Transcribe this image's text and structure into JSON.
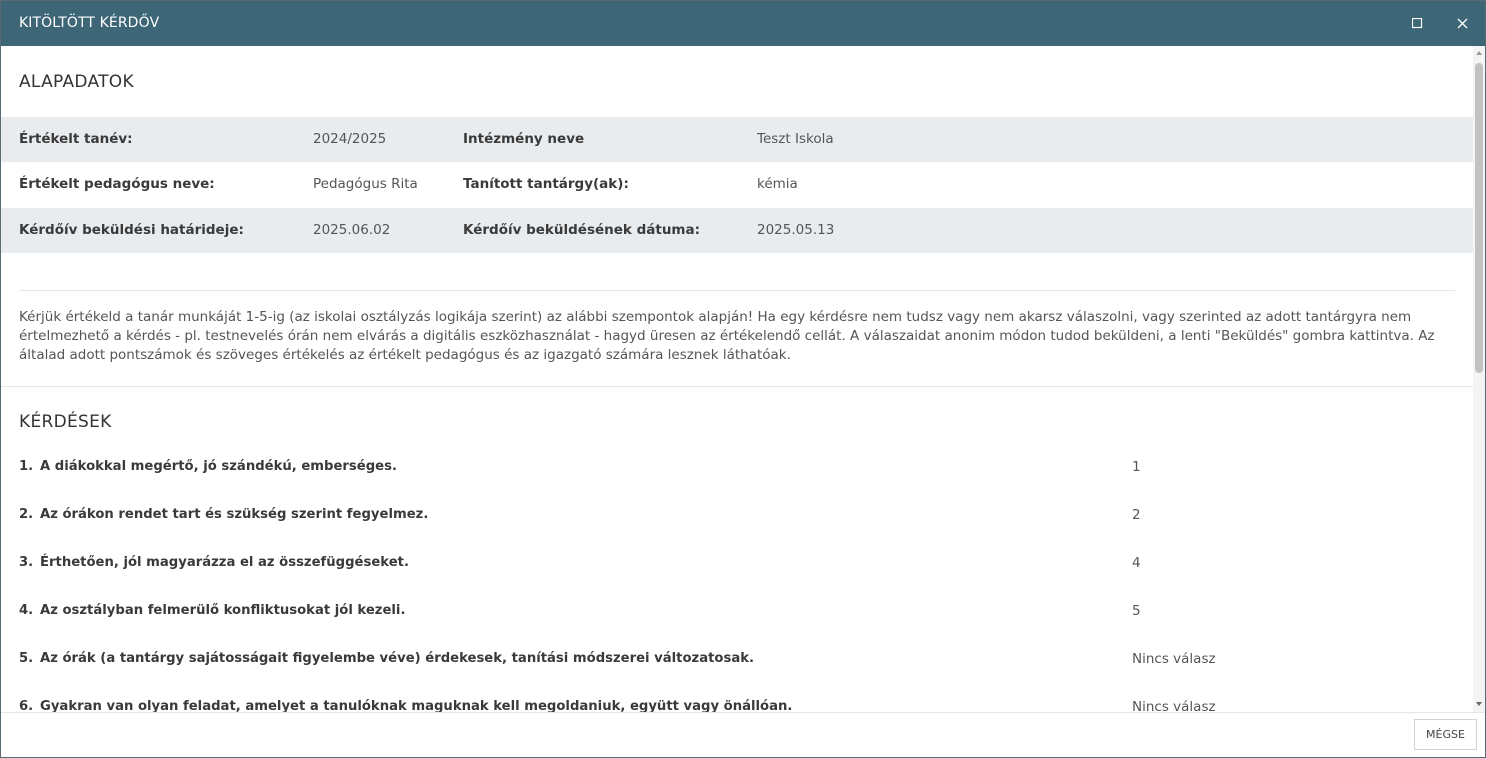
{
  "window": {
    "title": "KITÖLTÖTT KÉRDŐV",
    "maximize_icon": "maximize-icon",
    "close_icon": "close-icon",
    "title_bar_color": "#3d6677"
  },
  "basic_data": {
    "section_title": "ALAPADATOK",
    "rows": [
      {
        "label1": "Értékelt tanév:",
        "value1": "2024/2025",
        "label2": "Intézmény neve",
        "value2": "Teszt Iskola"
      },
      {
        "label1": "Értékelt pedagógus neve:",
        "value1": "Pedagógus Rita",
        "label2": "Tanított tantárgy(ak):",
        "value2": "kémia"
      },
      {
        "label1": "Kérdőív beküldési határideje:",
        "value1": "2025.06.02",
        "label2": "Kérdőív beküldésének dátuma:",
        "value2": "2025.05.13"
      }
    ]
  },
  "intro_text": "Kérjük értékeld a tanár munkáját 1-5-ig (az iskolai osztályzás logikája szerint) az alábbi szempontok alapján! Ha egy kérdésre nem tudsz vagy nem akarsz válaszolni, vagy szerinted az adott tantárgyra nem értelmezhető a kérdés - pl. testnevelés órán nem elvárás a digitális eszközhasználat - hagyd üresen az értékelendő cellát. A válaszaidat anonim módon tudod beküldeni, a lenti \"Beküldés\" gombra kattintva. Az általad adott pontszámok és szöveges értékelés az értékelt pedagógus és az igazgató számára lesznek láthatóak.",
  "questions": {
    "section_title": "KÉRDÉSEK",
    "items": [
      {
        "num": "1.",
        "text": "A diákokkal megértő, jó szándékú, emberséges.",
        "answer": "1"
      },
      {
        "num": "2.",
        "text": "Az órákon rendet tart és szükség szerint fegyelmez.",
        "answer": "2"
      },
      {
        "num": "3.",
        "text": "Érthetően, jól magyarázza el az összefüggéseket.",
        "answer": "4"
      },
      {
        "num": "4.",
        "text": "Az osztályban felmerülő konfliktusokat jól kezeli.",
        "answer": "5"
      },
      {
        "num": "5.",
        "text": "Az órák (a tantárgy sajátosságait figyelembe véve) érdekesek, tanítási módszerei változatosak.",
        "answer": "Nincs válasz"
      },
      {
        "num": "6.",
        "text": "Gyakran van olyan feladat, amelyet a tanulóknak maguknak kell megoldaniuk, együtt vagy önállóan.",
        "answer": "Nincs válasz"
      }
    ]
  },
  "footer": {
    "cancel_label": "MÉGSE"
  }
}
